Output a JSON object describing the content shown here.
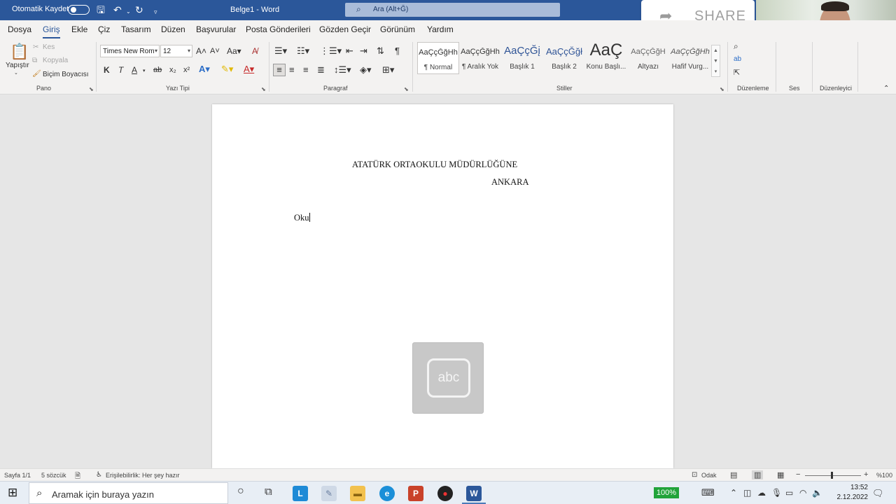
{
  "titlebar": {
    "autosave_label": "Otomatik Kaydet",
    "doc_title": "Belge1  -  Word",
    "search_placeholder": "Ara (Alt+Ğ)",
    "share_label": "SHARE"
  },
  "menu": {
    "items": [
      "Dosya",
      "Giriş",
      "Ekle",
      "Çiz",
      "Tasarım",
      "Düzen",
      "Başvurular",
      "Posta Gönderileri",
      "Gözden Geçir",
      "Görünüm",
      "Yardım"
    ],
    "active": "Giriş"
  },
  "ribbon": {
    "clipboard": {
      "label": "Pano",
      "paste": "Yapıştır",
      "cut": "Kes",
      "copy": "Kopyala",
      "format_painter": "Biçim Boyacısı"
    },
    "font": {
      "label": "Yazı Tipi",
      "font_name": "Times New Rom",
      "font_size": "12",
      "bold": "K",
      "italic": "T",
      "underline": "A"
    },
    "paragraph": {
      "label": "Paragraf"
    },
    "styles": {
      "label": "Stiller",
      "items": [
        {
          "sample": "AaÇçĞğHh",
          "name": "¶ Normal"
        },
        {
          "sample": "AaÇçĞğHh",
          "name": "¶ Aralık Yok"
        },
        {
          "sample": "AaÇçĞį",
          "name": "Başlık 1"
        },
        {
          "sample": "AaÇçĞğł",
          "name": "Başlık 2"
        },
        {
          "sample": "AaÇ",
          "name": "Konu Başlı..."
        },
        {
          "sample": "AaÇçĞğH",
          "name": "Altyazı"
        },
        {
          "sample": "AaÇçĞğHh",
          "name": "Hafif Vurg..."
        }
      ]
    },
    "editing": {
      "label": "Düzenleme"
    },
    "voice": {
      "label": "Ses"
    },
    "editor": {
      "label": "Düzenleyici"
    }
  },
  "document": {
    "line1": "ATATÜRK ORTAOKULU MÜDÜRLÜĞÜNE",
    "line2": "ANKARA",
    "line3": "Oku"
  },
  "statusbar": {
    "page": "Sayfa 1/1",
    "words": "5 sözcük",
    "accessibility": "Erişilebilirlik: Her şey hazır",
    "focus": "Odak",
    "zoom": "%100"
  },
  "taskbar": {
    "search_placeholder": "Aramak için buraya yazın",
    "battery": "100%",
    "time": "13:52",
    "date": "2.12.2022"
  },
  "colors": {
    "word_blue": "#2b579a",
    "battery_green": "#21a33a"
  }
}
